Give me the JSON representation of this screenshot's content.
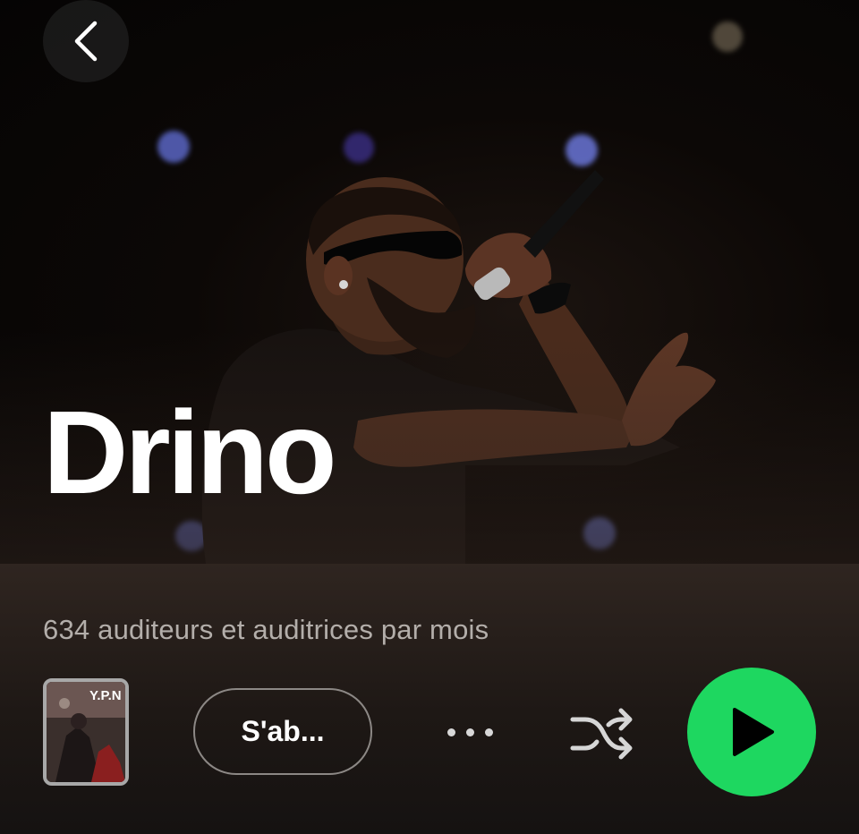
{
  "artist": {
    "name": "Drino",
    "monthly_listeners": "634 auditeurs et auditrices par mois"
  },
  "actions": {
    "follow_label": "S'ab...",
    "more_icon": "more-horizontal-icon",
    "shuffle_icon": "shuffle-icon",
    "play_icon": "play-icon",
    "back_icon": "chevron-left-icon"
  },
  "cover": {
    "label": "Y.P.N"
  },
  "colors": {
    "accent": "#1ed760",
    "background": "#121212",
    "secondary_text": "#b3aeaa"
  }
}
